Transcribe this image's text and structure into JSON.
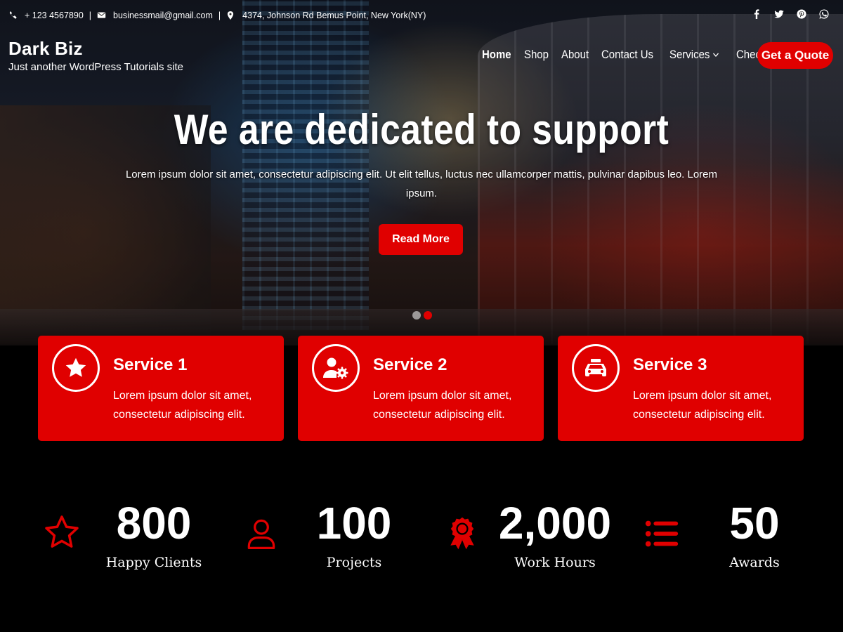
{
  "topbar": {
    "phone": "+ 123 4567890",
    "email": "businessmail@gmail.com",
    "address": "4374, Johnson Rd Bemus Point, New York(NY)",
    "separator": "|"
  },
  "social": [
    "facebook-icon",
    "twitter-icon",
    "pinterest-icon",
    "whatsapp-icon"
  ],
  "brand": {
    "title": "Dark Biz",
    "tagline": "Just another WordPress Tutorials site"
  },
  "nav": {
    "items": [
      "Home",
      "Shop",
      "About",
      "Contact Us",
      "Services",
      "Checkout"
    ],
    "active": "Home",
    "cta": "Get a Quote"
  },
  "hero": {
    "title": "We are dedicated to support",
    "text": "Lorem ipsum dolor sit amet, consectetur adipiscing elit. Ut elit tellus, luctus nec ullamcorper mattis, pulvinar dapibus leo. Lorem ipsum.",
    "button": "Read More",
    "slides": 2,
    "active_slide": 2
  },
  "services": [
    {
      "title": "Service 1",
      "desc": "Lorem ipsum dolor sit amet, consectetur adipiscing elit.",
      "icon": "star-icon"
    },
    {
      "title": "Service 2",
      "desc": "Lorem ipsum dolor sit amet, consectetur adipiscing elit.",
      "icon": "user-gear-icon"
    },
    {
      "title": "Service 3",
      "desc": "Lorem ipsum dolor sit amet, consectetur adipiscing elit.",
      "icon": "car-icon"
    }
  ],
  "stats": [
    {
      "number": "800",
      "label": "Happy Clients",
      "icon": "star-outline-icon"
    },
    {
      "number": "100",
      "label": "Projects",
      "icon": "user-outline-icon"
    },
    {
      "number": "2,000",
      "label": "Work Hours",
      "icon": "award-icon"
    },
    {
      "number": "50",
      "label": "Awards",
      "icon": "list-icon"
    }
  ],
  "colors": {
    "accent": "#e00000",
    "background": "#000000",
    "text": "#ffffff"
  }
}
